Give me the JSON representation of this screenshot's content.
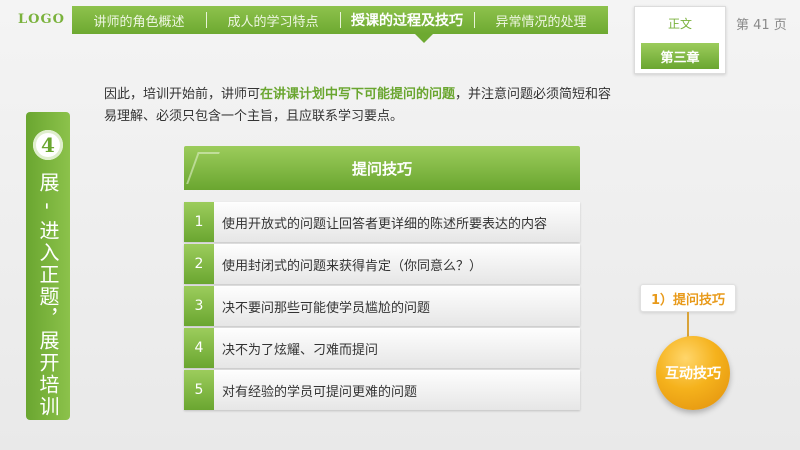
{
  "header": {
    "logo": "LOGO",
    "tabs": [
      {
        "label": "讲师的角色概述"
      },
      {
        "label": "成人的学习特点"
      },
      {
        "label": "授课的过程及技巧"
      },
      {
        "label": "异常情况的处理"
      }
    ],
    "active_tab_index": 2,
    "chapter_label": "正文",
    "chapter_title": "第三章",
    "page_number": "第 41 页"
  },
  "sidebar": {
    "number": "4",
    "text": "展 - 进入正题，展开培训"
  },
  "intro": {
    "prefix": "因此，培训开始前，讲师可",
    "highlight": "在讲课计划中写下可能提问的问题",
    "suffix": "，并注意问题必须简短和容易理解、必须只包含一个主旨，且应联系学习要点。"
  },
  "table": {
    "title": "提问技巧",
    "rows": [
      {
        "num": "1",
        "text": "使用开放式的问题让回答者更详细的陈述所要表达的内容"
      },
      {
        "num": "2",
        "text": "使用封闭式的问题来获得肯定（你同意么？）"
      },
      {
        "num": "3",
        "text": "决不要问那些可能使学员尴尬的问题"
      },
      {
        "num": "4",
        "text": "决不为了炫耀、刁难而提问"
      },
      {
        "num": "5",
        "text": "对有经验的学员可提问更难的问题"
      }
    ]
  },
  "right": {
    "tab_label": "1）提问技巧",
    "circle_label": "互动技巧"
  },
  "colors": {
    "accent_green": "#6aa630",
    "accent_orange": "#f5b21c"
  }
}
